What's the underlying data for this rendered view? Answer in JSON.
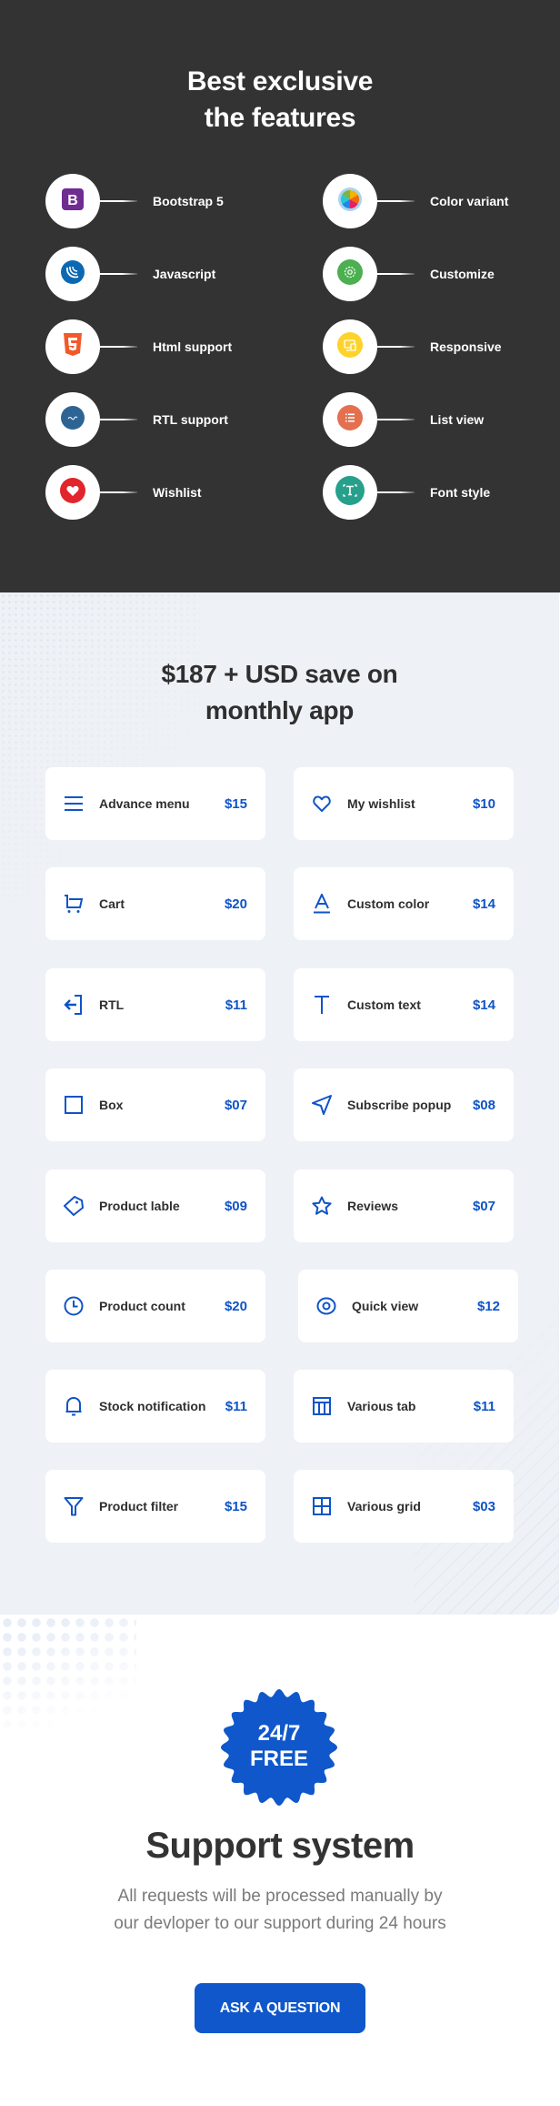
{
  "features": {
    "title_line1": "Best exclusive",
    "title_line2": "the features",
    "items": [
      {
        "label": "Bootstrap 5",
        "icon": "bootstrap-icon",
        "color": "#6f2c91"
      },
      {
        "label": "Color variant",
        "icon": "color-wheel-icon",
        "color": "#8ecae6"
      },
      {
        "label": "Javascript",
        "icon": "jquery-icon",
        "color": "#0b69b3"
      },
      {
        "label": "Customize",
        "icon": "gear-icon",
        "color": "#4caf50"
      },
      {
        "label": "Html support",
        "icon": "html5-icon",
        "color": "#f1592a"
      },
      {
        "label": "Responsive",
        "icon": "devices-icon",
        "color": "#fdd32a"
      },
      {
        "label": "RTL support",
        "icon": "rtl-text-icon",
        "color": "#2d6494"
      },
      {
        "label": "List view",
        "icon": "list-icon",
        "color": "#e4704f"
      },
      {
        "label": "Wishlist",
        "icon": "heart-icon",
        "color": "#e2242c"
      },
      {
        "label": "Font style",
        "icon": "text-select-icon",
        "color": "#26a08b"
      }
    ]
  },
  "pricing": {
    "title_line1": "$187 + USD save on",
    "title_line2": "monthly app",
    "accent": "#0f54c6",
    "items": [
      {
        "label": "Advance menu",
        "price": "$15",
        "icon": "menu-icon"
      },
      {
        "label": "My wishlist",
        "price": "$10",
        "icon": "heart-outline-icon"
      },
      {
        "label": "Cart",
        "price": "$20",
        "icon": "cart-icon"
      },
      {
        "label": "Custom color",
        "price": "$14",
        "icon": "text-color-icon"
      },
      {
        "label": "RTL",
        "price": "$11",
        "icon": "login-arrow-icon"
      },
      {
        "label": "Custom text",
        "price": "$14",
        "icon": "type-icon"
      },
      {
        "label": "Box",
        "price": "$07",
        "icon": "square-icon"
      },
      {
        "label": "Subscribe popup",
        "price": "$08",
        "icon": "navigation-icon"
      },
      {
        "label": "Product lable",
        "price": "$09",
        "icon": "tag-icon"
      },
      {
        "label": "Reviews",
        "price": "$07",
        "icon": "star-icon"
      },
      {
        "label": "Product count",
        "price": "$20",
        "icon": "clock-icon"
      },
      {
        "label": "Quick view",
        "price": "$12",
        "icon": "eye-icon"
      },
      {
        "label": "Stock notification",
        "price": "$11",
        "icon": "bell-icon"
      },
      {
        "label": "Various tab",
        "price": "$11",
        "icon": "table-icon"
      },
      {
        "label": "Product filter",
        "price": "$15",
        "icon": "filter-icon"
      },
      {
        "label": "Various grid",
        "price": "$03",
        "icon": "grid-icon"
      }
    ]
  },
  "support": {
    "badge_line1": "24/7",
    "badge_line2": "FREE",
    "badge_color": "#0f57ca",
    "title": "Support system",
    "desc_line1": "All requests will be processed manually by",
    "desc_line2": "our devloper to our support during 24 hours",
    "button_label": "ASK A QUESTION"
  }
}
